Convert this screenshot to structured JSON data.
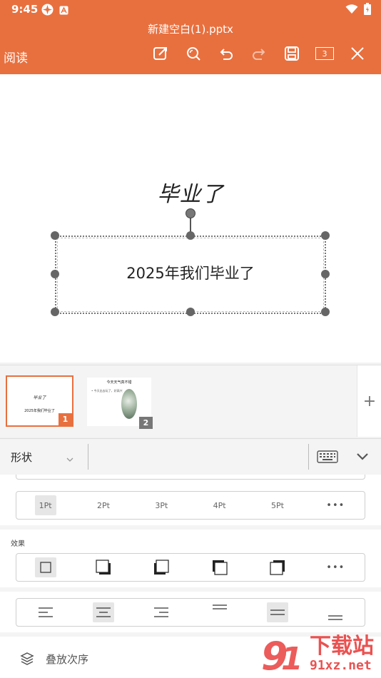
{
  "status_bar": {
    "time": "9:45"
  },
  "header": {
    "doc_title": "新建空白(1).pptx",
    "read_label": "阅读",
    "page_count": "3"
  },
  "slide": {
    "title": "毕业了",
    "subtitle": "2025年我们毕业了"
  },
  "thumbnails": [
    {
      "number": "1",
      "title": "毕业了",
      "subtitle": "2025年我们毕业了"
    },
    {
      "number": "2",
      "title": "今天天气真不错",
      "bullet": "• 今天出去玩了，好高兴"
    }
  ],
  "add_slide_label": "+",
  "panel": {
    "type_label": "形状",
    "line_widths": [
      "1Pt",
      "2Pt",
      "3Pt",
      "4Pt",
      "5Pt"
    ],
    "more_label": "•••",
    "effects_label": "效果",
    "layer_order_label": "叠放次序"
  },
  "watermark": {
    "brand": "下载站",
    "site": "91xz.net"
  },
  "colors": {
    "accent": "#e8703f"
  }
}
